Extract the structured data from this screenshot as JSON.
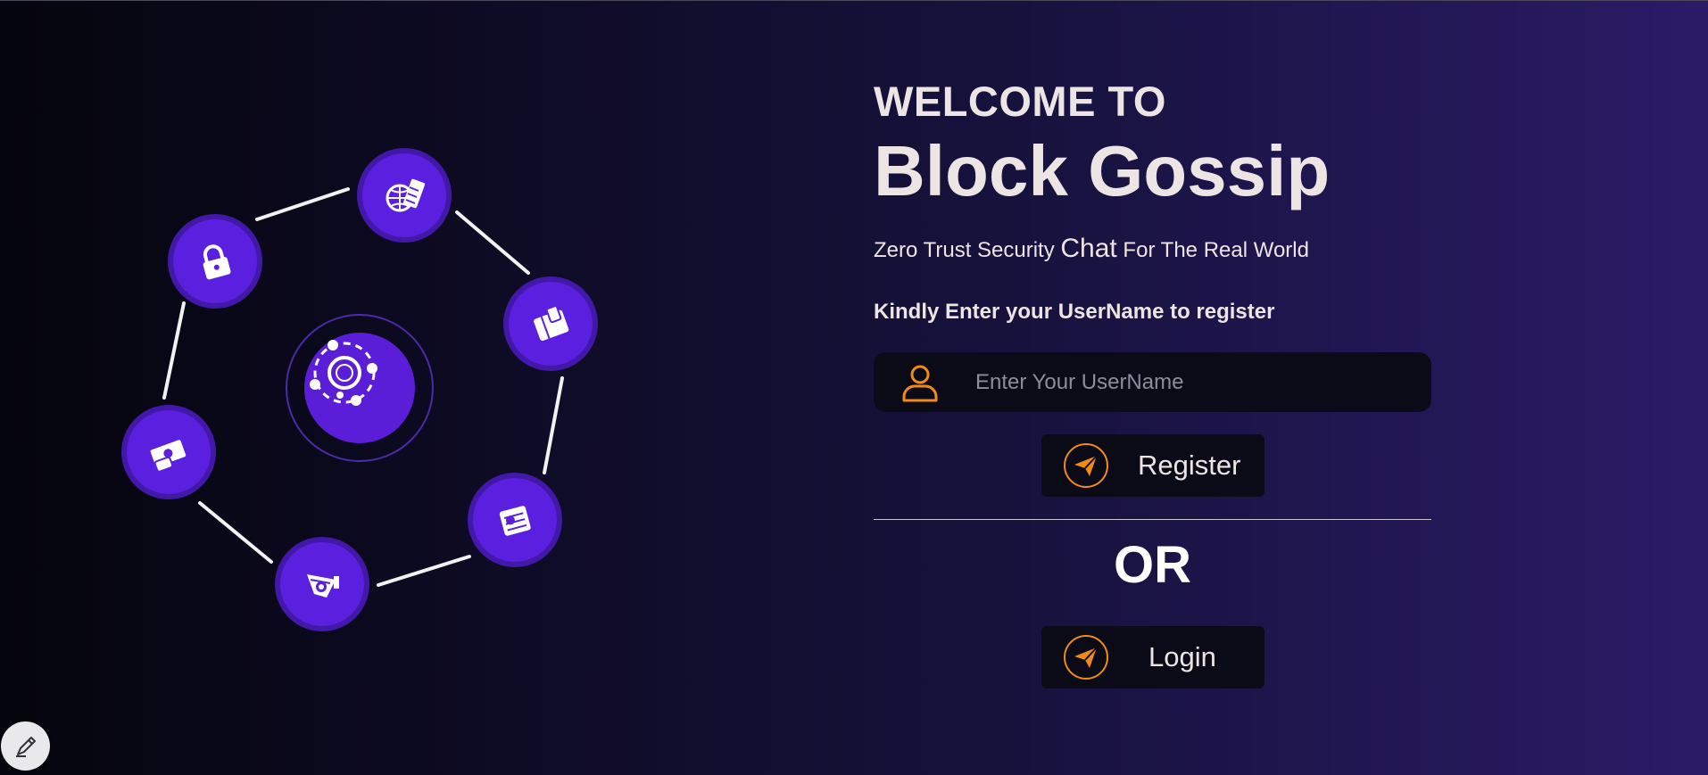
{
  "heading": {
    "welcome": "WELCOME TO",
    "brand": "Block Gossip"
  },
  "tagline": {
    "before": "Zero Trust Security ",
    "emphasis": "Chat",
    "after": " For The Real World"
  },
  "form": {
    "instruction": "Kindly Enter your UserName to register",
    "username_placeholder": "Enter Your UserName",
    "username_value": "",
    "register_label": "Register",
    "or_label": "OR",
    "login_label": "Login"
  },
  "icons": {
    "user": "user-icon",
    "send": "paper-plane-icon",
    "edit": "pen-icon",
    "network_nodes": [
      "globe-server-icon",
      "wallet-icon",
      "coin-stack-icon",
      "mining-cart-icon",
      "money-hand-icon",
      "padlock-icon"
    ],
    "center": "blockchain-network-icon"
  },
  "colors": {
    "accent_orange": "#f28a16",
    "node_purple": "#5b1fe0",
    "text": "#ede4e4",
    "button_bg": "#0b0b18"
  }
}
